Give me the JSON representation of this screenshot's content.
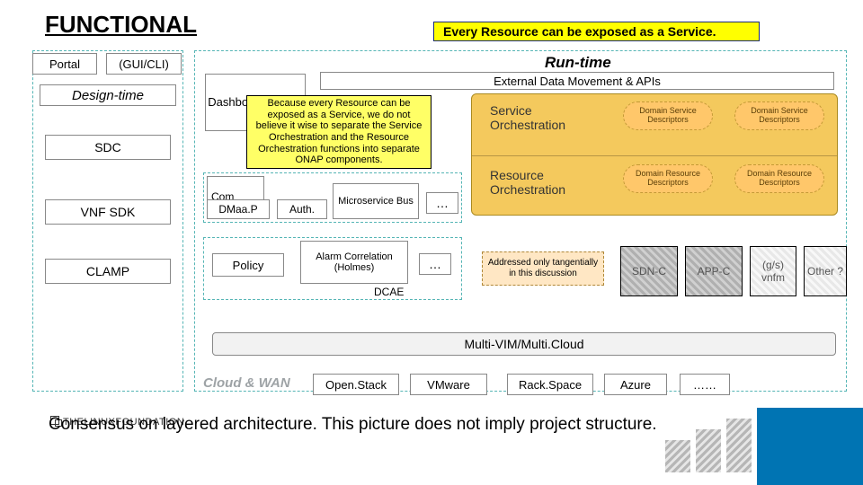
{
  "headline": "FUNCTIONAL",
  "banner": "Every Resource can be exposed as a Service.",
  "runtime_title": "Run-time",
  "left": {
    "portal": "Portal",
    "guicli": "(GUI/CLI)",
    "design_time": "Design-time",
    "sdc": "SDC",
    "vnf_sdk": "VNF SDK",
    "clamp": "CLAMP"
  },
  "mid": {
    "dashboard": "Dashboard OA&M",
    "com_prefix": "Com",
    "dmaap": "DMaa.P",
    "auth": "Auth.",
    "msb": "Micro​service Bus",
    "dots": "…",
    "policy": "Policy",
    "holmes": "Alarm Correlation (Holmes)",
    "dcae": "DCAE",
    "dots2": "…"
  },
  "apis_bar": "External Data Movement & APIs",
  "callout": "Because every Resource can be exposed as a Service, we do not believe it wise to separate the Service Orchestration and the Resource Orchestration functions into separate ONAP components.",
  "orch": {
    "service": "Service Orchestration",
    "resource": "Resource Orchestration",
    "svc_chip": "Domain Service Descriptors",
    "res_chip": "Domain Resource Descriptors"
  },
  "tang": "Addressed only tangentially in this discussion",
  "hatch": {
    "sdnc": "SDN-C",
    "appc": "APP-C",
    "vnfm": "(g/s) vnfm",
    "other": "Other ?"
  },
  "mvim": "Multi-VIM/Multi.Cloud",
  "cloudwan": "Cloud & WAN",
  "clouds": {
    "openstack": "Open.Stack",
    "vmware": "VMware",
    "rackspace": "Rack.Space",
    "azure": "Azure",
    "more": "……"
  },
  "consensus": "Consensus on layered architecture.  This picture does not imply project structure.",
  "logo": "THELINUXFOUNDATION"
}
